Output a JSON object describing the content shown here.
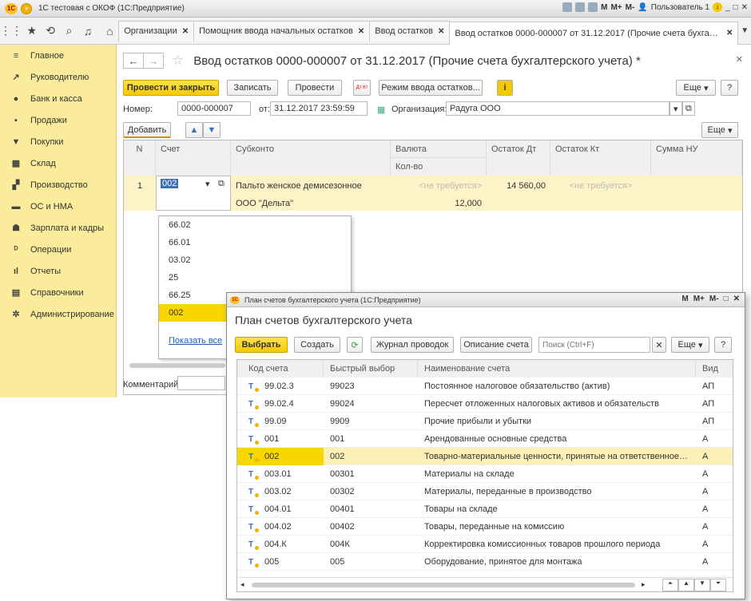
{
  "window": {
    "title": "1С тестовая с ОКОФ  (1С:Предприятие)",
    "user": "Пользователь 1",
    "m_labels": [
      "M",
      "M+",
      "M-"
    ]
  },
  "tabs": [
    {
      "label": "Организации"
    },
    {
      "label": "Помощник ввода начальных остатков"
    },
    {
      "label": "Ввод остатков"
    },
    {
      "label": "Ввод остатков 0000-000007 от 31.12.2017 (Прочие счета бухгалтерско..."
    }
  ],
  "sidebar": {
    "items": [
      {
        "label": "Главное",
        "icon": "≡"
      },
      {
        "label": "Руководителю",
        "icon": "↗"
      },
      {
        "label": "Банк и касса",
        "icon": "●"
      },
      {
        "label": "Продажи",
        "icon": "▪"
      },
      {
        "label": "Покупки",
        "icon": "▼"
      },
      {
        "label": "Склад",
        "icon": "▦"
      },
      {
        "label": "Производство",
        "icon": "▞"
      },
      {
        "label": "ОС и НМА",
        "icon": "▬"
      },
      {
        "label": "Зарплата и кадры",
        "icon": "☗"
      },
      {
        "label": "Операции",
        "icon": "ᴰ"
      },
      {
        "label": "Отчеты",
        "icon": "ıl"
      },
      {
        "label": "Справочники",
        "icon": "▤"
      },
      {
        "label": "Администрирование",
        "icon": "✲"
      }
    ]
  },
  "doc": {
    "title": "Ввод остатков 0000-000007 от 31.12.2017 (Прочие счета бухгалтерского учета) *",
    "buttons": {
      "post_close": "Провести и закрыть",
      "save": "Записать",
      "post": "Провести",
      "mode": "Режим ввода остатков...",
      "more": "Еще",
      "help": "?",
      "dtkt": "Дт Кт",
      "info": "i"
    },
    "number_label": "Номер:",
    "number": "0000-000007",
    "date_label": "от:",
    "date": "31.12.2017 23:59:59",
    "org_label": "Организация:",
    "org": "Радуга ООО",
    "add": "Добавить",
    "more2": "Еще",
    "comment_label": "Комментарий:"
  },
  "grid": {
    "headers": {
      "n": "N",
      "account": "Счет",
      "subconto": "Субконто",
      "currency": "Валюта",
      "qty": "Кол-во",
      "dt": "Остаток Дт",
      "kt": "Остаток Кт",
      "nu": "Сумма НУ"
    },
    "row": {
      "n": "1",
      "account": "002",
      "sub1": "Пальто женское демисезонное",
      "sub2": "ООО \"Дельта\"",
      "currency": "<не требуется>",
      "qty": "12,000",
      "dt": "14 560,00",
      "kt": "<не требуется>"
    }
  },
  "dropdown": {
    "items": [
      "66.02",
      "66.01",
      "03.02",
      "25",
      "66.25",
      "002"
    ],
    "show_all": "Показать все"
  },
  "popup": {
    "window_title": "План счетов бухгалтерского учета  (1С:Предприятие)",
    "title": "План счетов бухгалтерского учета",
    "buttons": {
      "select": "Выбрать",
      "create": "Создать",
      "journal": "Журнал проводок",
      "desc": "Описание счета",
      "more": "Еще",
      "help": "?"
    },
    "search_placeholder": "Поиск (Ctrl+F)",
    "headers": {
      "code": "Код счета",
      "quick": "Быстрый выбор",
      "name": "Наименование счета",
      "kind": "Вид"
    },
    "rows": [
      {
        "code": "99.02.3",
        "quick": "99023",
        "name": "Постоянное налоговое обязательство (актив)",
        "kind": "АП"
      },
      {
        "code": "99.02.4",
        "quick": "99024",
        "name": "Пересчет отложенных налоговых активов и обязательств",
        "kind": "АП"
      },
      {
        "code": "99.09",
        "quick": "9909",
        "name": "Прочие прибыли и убытки",
        "kind": "АП"
      },
      {
        "code": "001",
        "quick": "001",
        "name": "Арендованные основные средства",
        "kind": "А"
      },
      {
        "code": "002",
        "quick": "002",
        "name": "Товарно-материальные ценности, принятые на ответственное хране...",
        "kind": "А"
      },
      {
        "code": "003.01",
        "quick": "00301",
        "name": "Материалы на складе",
        "kind": "А"
      },
      {
        "code": "003.02",
        "quick": "00302",
        "name": "Материалы, переданные в производство",
        "kind": "А"
      },
      {
        "code": "004.01",
        "quick": "00401",
        "name": "Товары на складе",
        "kind": "А"
      },
      {
        "code": "004.02",
        "quick": "00402",
        "name": "Товары, переданные на комиссию",
        "kind": "А"
      },
      {
        "code": "004.К",
        "quick": "004К",
        "name": "Корректировка комиссионных товаров прошлого периода",
        "kind": "А"
      },
      {
        "code": "005",
        "quick": "005",
        "name": "Оборудование, принятое для монтажа",
        "kind": "А"
      }
    ]
  }
}
